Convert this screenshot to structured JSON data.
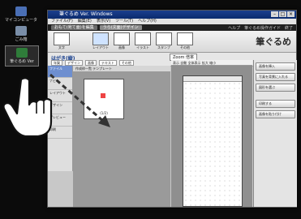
{
  "desktop": {
    "icons": [
      {
        "name": "my-computer-icon",
        "label": "マイコンピュータ",
        "color": "#4a6fb5"
      },
      {
        "name": "recycle-bin-icon",
        "label": "ごみ箱",
        "color": "#7a8ea8"
      },
      {
        "name": "app-shortcut-icon",
        "label": "筆ぐるめ Ver",
        "color": "#2f7d3a"
      }
    ]
  },
  "window": {
    "title": "筆ぐるめ Ver. Windows",
    "menu": [
      "ファイル(F)",
      "編集(E)",
      "表示(V)",
      "ツール(T)",
      "ヘルプ(H)"
    ],
    "mode_tabs": [
      "おもて(宛て面)を編集",
      "うら(文面)デザイン"
    ],
    "mode_right": [
      "ヘルプ",
      "筆ぐるめ操作ガイド",
      "終了",
      "ヘルプ",
      "閉じる"
    ],
    "tools": [
      "文字",
      "レイアウト",
      "画像",
      "イラスト",
      "スタンプ",
      "その他"
    ],
    "logo": "筆ぐるめ",
    "layout_title": "はがき(縦)",
    "layout_pills": [
      "年賀",
      "デザイン",
      "画像",
      "テキスト",
      "その他"
    ],
    "view_tab": "Zoom  倍率",
    "left_items": [
      "ファイル",
      "ナビ",
      "レイアウト",
      "デザイン",
      "プレビュー",
      "印刷"
    ],
    "mid_header": "作成枠一覧  テンプレート",
    "thumb_caption": "(1/2)",
    "ruler_text": "表示 自動 全体表示 拡大 縮小",
    "right_buttons": [
      "画像を挿入",
      "写真を背景に入れる",
      "図形を選ぶ",
      "印刷する",
      "画像を貼り付け"
    ]
  },
  "overlay": {
    "hand": "pointer-hand-icon",
    "arrow": "dashed-drag-arrow"
  }
}
